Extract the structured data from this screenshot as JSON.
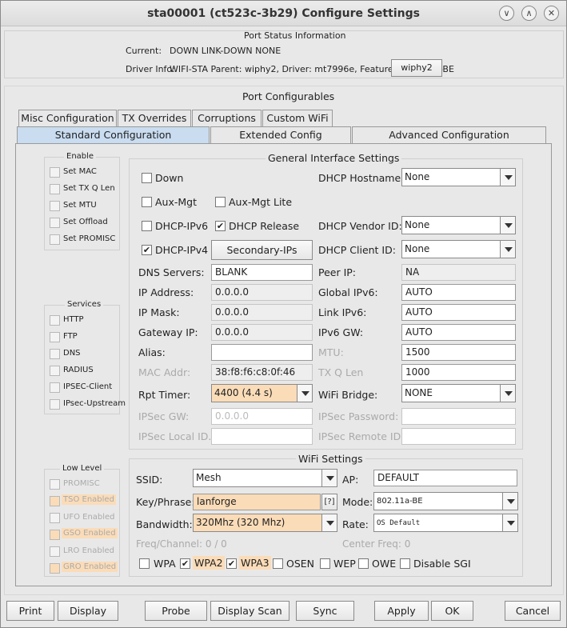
{
  "window": {
    "title": "sta00001  (ct523c-3b29) Configure Settings",
    "minimize_glyph": "∨",
    "maximize_glyph": "∧",
    "close_glyph": "✕"
  },
  "port_status": {
    "title": "Port Status Information",
    "current_label": "Current:",
    "current_value": "DOWN LINK-DOWN  NONE",
    "driver_label": "Driver Info:",
    "driver_value": "WIFI-STA Parent: wiphy2, Driver: mt7996e, Features: 802.11a-BE",
    "parent_button": "wiphy2"
  },
  "configurables_title": "Port Configurables",
  "tabs_row1": [
    "Misc Configuration",
    "TX Overrides",
    "Corruptions",
    "Custom WiFi"
  ],
  "tabs_row2": [
    "Standard Configuration",
    "Extended Config",
    "Advanced Configuration"
  ],
  "enable_group": {
    "title": "Enable",
    "items": [
      "Set MAC",
      "Set TX Q Len",
      "Set MTU",
      "Set Offload",
      "Set PROMISC"
    ]
  },
  "services_group": {
    "title": "Services",
    "items": [
      "HTTP",
      "FTP",
      "DNS",
      "RADIUS",
      "IPSEC-Client",
      "IPsec-Upstream"
    ]
  },
  "lowlevel_group": {
    "title": "Low Level",
    "items": [
      "PROMISC",
      "TSO Enabled",
      "UFO Enabled",
      "GSO Enabled",
      "LRO Enabled",
      "GRO Enabled"
    ]
  },
  "general": {
    "title": "General Interface Settings",
    "down": "Down",
    "aux_mgt": "Aux-Mgt",
    "aux_mgt_lite": "Aux-Mgt Lite",
    "dhcp_ipv6": "DHCP-IPv6",
    "dhcp_release": "DHCP Release",
    "dhcp_ipv4": "DHCP-IPv4",
    "secondary_ips": "Secondary-IPs",
    "dhcp_hostname_label": "DHCP Hostname:",
    "dhcp_hostname": "None",
    "dhcp_vendor_label": "DHCP Vendor ID:",
    "dhcp_vendor": "None",
    "dhcp_client_label": "DHCP Client ID:",
    "dhcp_client": "None",
    "dns_label": "DNS Servers:",
    "dns": "BLANK",
    "peer_ip_label": "Peer IP:",
    "peer_ip": "NA",
    "ip_label": "IP Address:",
    "ip": "0.0.0.0",
    "global_ipv6_label": "Global IPv6:",
    "global_ipv6": "AUTO",
    "mask_label": "IP Mask:",
    "mask": "0.0.0.0",
    "link_ipv6_label": "Link IPv6:",
    "link_ipv6": "AUTO",
    "gateway_label": "Gateway IP:",
    "gateway": "0.0.0.0",
    "ipv6_gw_label": "IPv6 GW:",
    "ipv6_gw": "AUTO",
    "alias_label": "Alias:",
    "alias": "",
    "mtu_label": "MTU:",
    "mtu": "1500",
    "mac_label": "MAC Addr:",
    "mac": "38:f8:f6:c8:0f:46",
    "txq_label": "TX Q Len",
    "txq": "1000",
    "rpt_label": "Rpt Timer:",
    "rpt": "4400 (4.4 s)",
    "wifi_bridge_label": "WiFi Bridge:",
    "wifi_bridge": "NONE",
    "ipsec_gw_label": "IPSec GW:",
    "ipsec_gw": "0.0.0.0",
    "ipsec_pw_label": "IPSec Password:",
    "ipsec_local_label": "IPSec Local ID.:",
    "ipsec_remote_label": "IPSec Remote ID.:"
  },
  "wifi": {
    "title": "WiFi Settings",
    "ssid_label": "SSID:",
    "ssid": "Mesh",
    "ap_label": "AP:",
    "ap": "DEFAULT",
    "key_label": "Key/Phrase:",
    "key": "lanforge",
    "help": "[?]",
    "mode_label": "Mode:",
    "mode": "802.11a-BE",
    "bw_label": "Bandwidth:",
    "bw": "320Mhz (320 Mhz)",
    "rate_label": "Rate:",
    "rate": "OS Default",
    "freq": "Freq/Channel: 0 / 0",
    "center": "Center Freq: 0",
    "security": [
      "WPA",
      "WPA2",
      "WPA3",
      "OSEN",
      "WEP",
      "OWE",
      "Disable SGI"
    ]
  },
  "buttons": [
    "Print",
    "Display",
    "Probe",
    "Display Scan",
    "Sync",
    "Apply",
    "OK",
    "Cancel"
  ],
  "check_glyph": "✔"
}
